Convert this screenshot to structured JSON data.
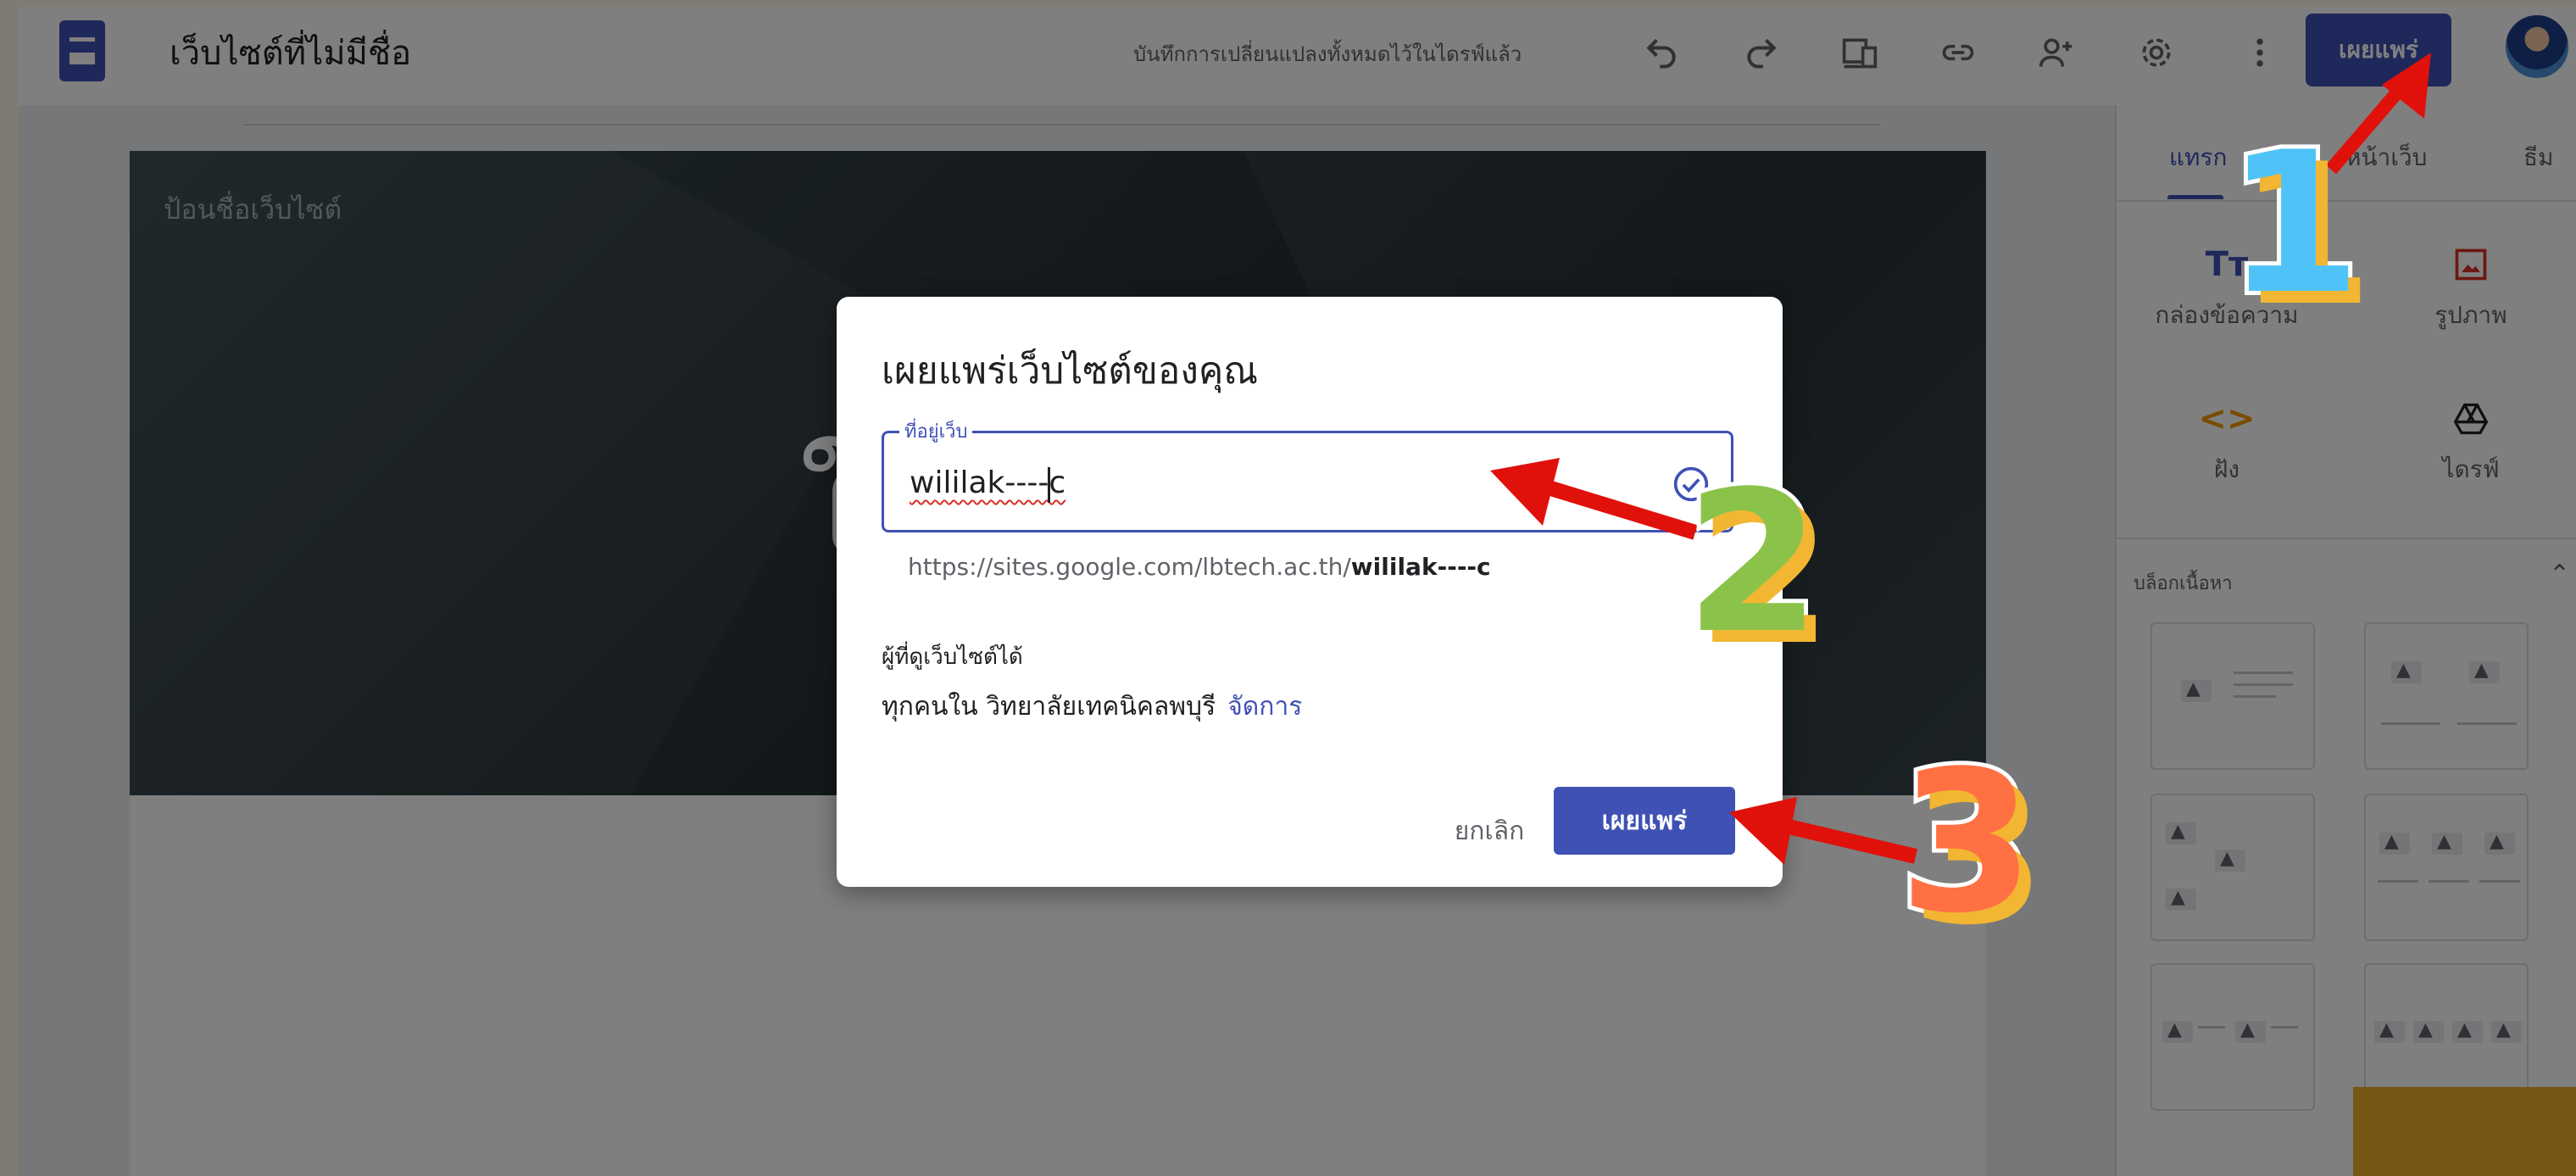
{
  "topbar": {
    "site_title": "เว็บไซต์ที่ไม่มีชื่อ",
    "save_status": "บันทึกการเปลี่ยนแปลงทั้งหมดไว้ในไดรฟ์แล้ว",
    "publish_label": "เผยแพร่",
    "icons": [
      "undo-icon",
      "redo-icon",
      "preview-icon",
      "link-icon",
      "share-icon",
      "settings-icon",
      "more-icon"
    ]
  },
  "banner": {
    "site_name_placeholder": "ป้อนชื่อเว็บไซต์",
    "big_letter": "ใ"
  },
  "panel": {
    "tabs": [
      "แทรก",
      "หน้าเว็บ",
      "ธีม"
    ],
    "tools": [
      {
        "label": "กล่องข้อความ",
        "icon": "text-box-icon"
      },
      {
        "label": "รูปภาพ",
        "icon": "image-icon"
      },
      {
        "label": "ฝัง",
        "icon": "embed-icon"
      },
      {
        "label": "ไดรฟ์",
        "icon": "drive-icon"
      }
    ],
    "blocks_label": "บล็อกเนื้อหา"
  },
  "dialog": {
    "title": "เผยแพร่เว็บไซต์ของคุณ",
    "field_label": "ที่อยู่เว็บ",
    "field_value": "wililak----c",
    "url_prefix": "https://sites.google.com/lbtech.ac.th/",
    "url_suffix": "wililak----c",
    "viewers_label": "ผู้ที่ดูเว็บไซต์ได้",
    "viewers_value": "ทุกคนใน วิทยาลัยเทคนิคลพบุรี",
    "manage_link": "จัดการ",
    "cancel_label": "ยกเลิก",
    "publish_label": "เผยแพร่"
  },
  "annotations": {
    "step1": "1",
    "step2": "2",
    "step3": "3",
    "arrow_color": "#e0110b"
  }
}
